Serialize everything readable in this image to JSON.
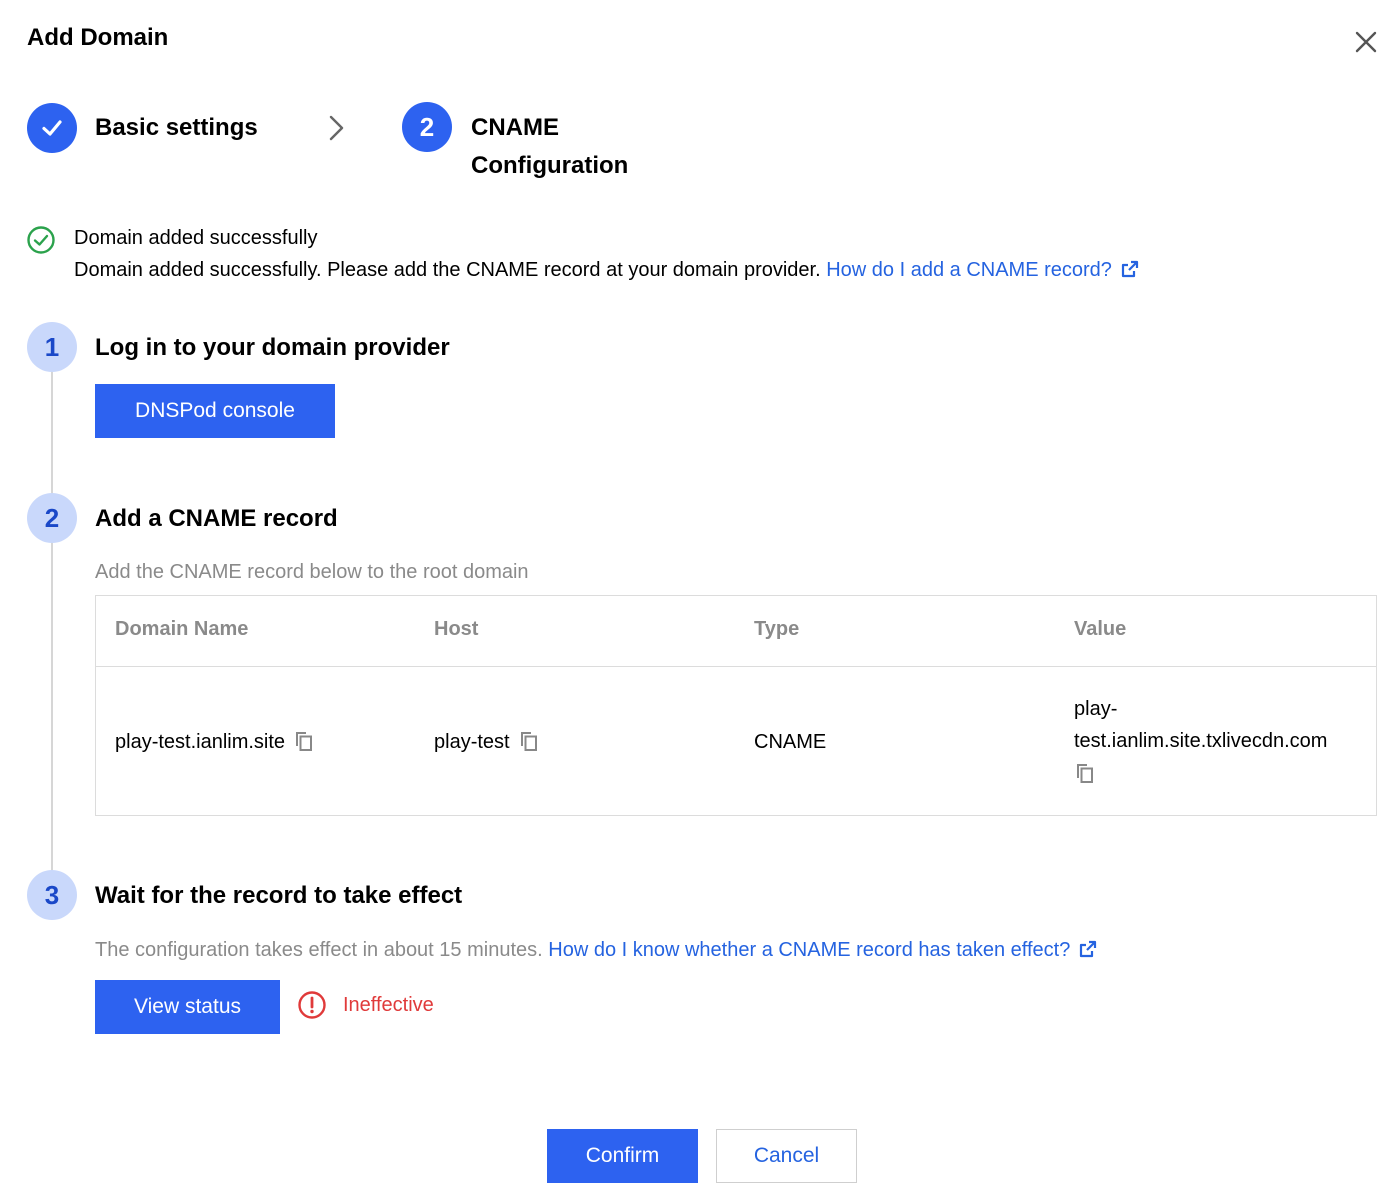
{
  "dialog": {
    "title": "Add Domain"
  },
  "stepper": {
    "steps": [
      {
        "label": "Basic settings",
        "state": "done"
      },
      {
        "number": "2",
        "label_line1": "CNAME",
        "label_line2": "Configuration",
        "state": "active"
      }
    ]
  },
  "notice": {
    "title": "Domain added successfully",
    "text": "Domain added successfully. Please add the CNAME record at your domain provider.",
    "link": "How do I add a CNAME record?"
  },
  "sections": [
    {
      "number": "1",
      "title": "Log in to your domain provider",
      "button": "DNSPod console"
    },
    {
      "number": "2",
      "title": "Add a CNAME record",
      "hint": "Add the CNAME record below to the root domain"
    },
    {
      "number": "3",
      "title": "Wait for the record to take effect",
      "hint": "The configuration takes effect in about 15 minutes.",
      "link": "How do I know whether a CNAME record has taken effect?",
      "button": "View status",
      "status": "Ineffective"
    }
  ],
  "table": {
    "headers": [
      "Domain Name",
      "Host",
      "Type",
      "Value"
    ],
    "row": {
      "domain": "play-test.ianlim.site",
      "host": "play-test",
      "type": "CNAME",
      "value_line1": "play-",
      "value_line2": "test.ianlim.site.txlivecdn.com"
    }
  },
  "footer": {
    "confirm": "Confirm",
    "cancel": "Cancel"
  },
  "colors": {
    "primary": "#2d62f0",
    "link": "#2563e0",
    "success": "#2ba24c",
    "error": "#e03a3a",
    "muted": "#8a8a8a"
  },
  "icons": {
    "close": "close-icon",
    "check": "check-icon",
    "chevron": "chevron-right-icon",
    "success": "success-check-icon",
    "external": "external-link-icon",
    "copy": "copy-icon",
    "warning": "warning-circle-icon"
  }
}
